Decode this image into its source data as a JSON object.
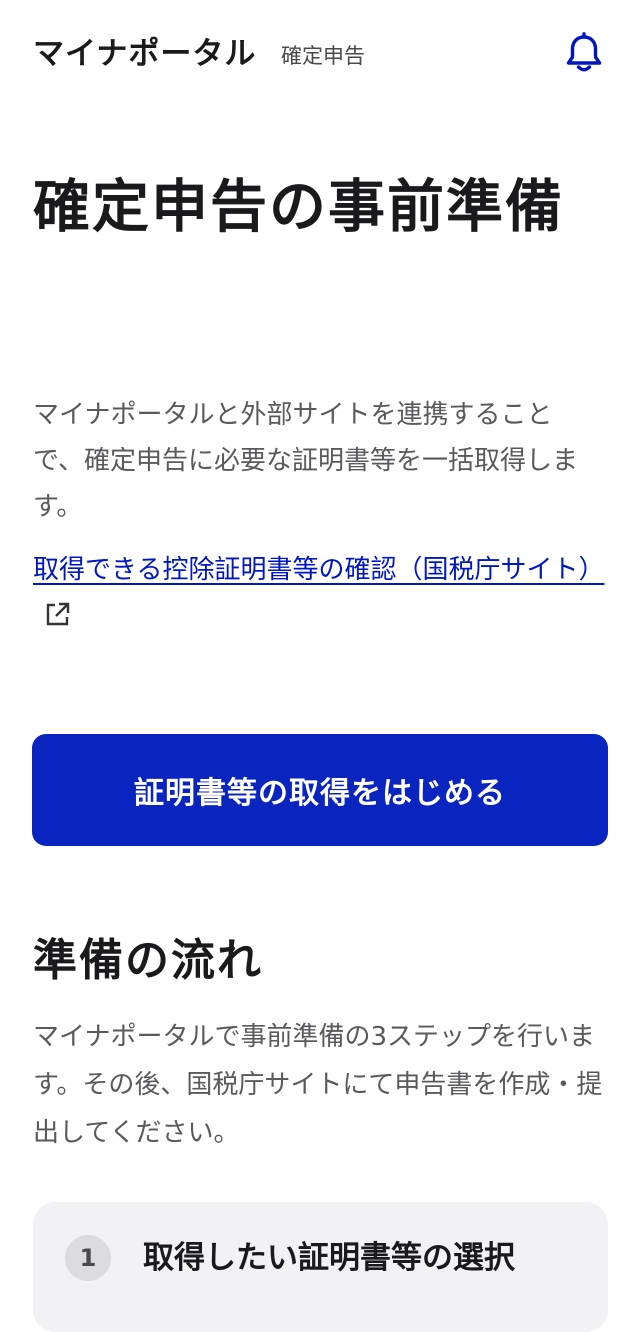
{
  "header": {
    "brand": "マイナポータル",
    "section": "確定申告",
    "notification_icon": "bell-icon",
    "accent_color": "#0017c1"
  },
  "main": {
    "title": "確定申告の事前準備",
    "intro": "マイナポータルと外部サイトを連携することで、確定申告に必要な証明書等を一括取得します。",
    "external_link": {
      "label": "取得できる控除証明書等の確認（国税庁サイト）",
      "icon": "external-link-icon"
    },
    "primary_button": "証明書等の取得をはじめる"
  },
  "flow": {
    "heading": "準備の流れ",
    "description": "マイナポータルで事前準備の3ステップを行います。その後、国税庁サイトにて申告書を作成・提出してください。",
    "steps": [
      {
        "number": "1",
        "label": "取得したい証明書等の選択"
      }
    ]
  },
  "colors": {
    "primary_button_bg": "#0a24bf",
    "link": "#0017c1",
    "step_card_bg": "#f2f2f5"
  }
}
